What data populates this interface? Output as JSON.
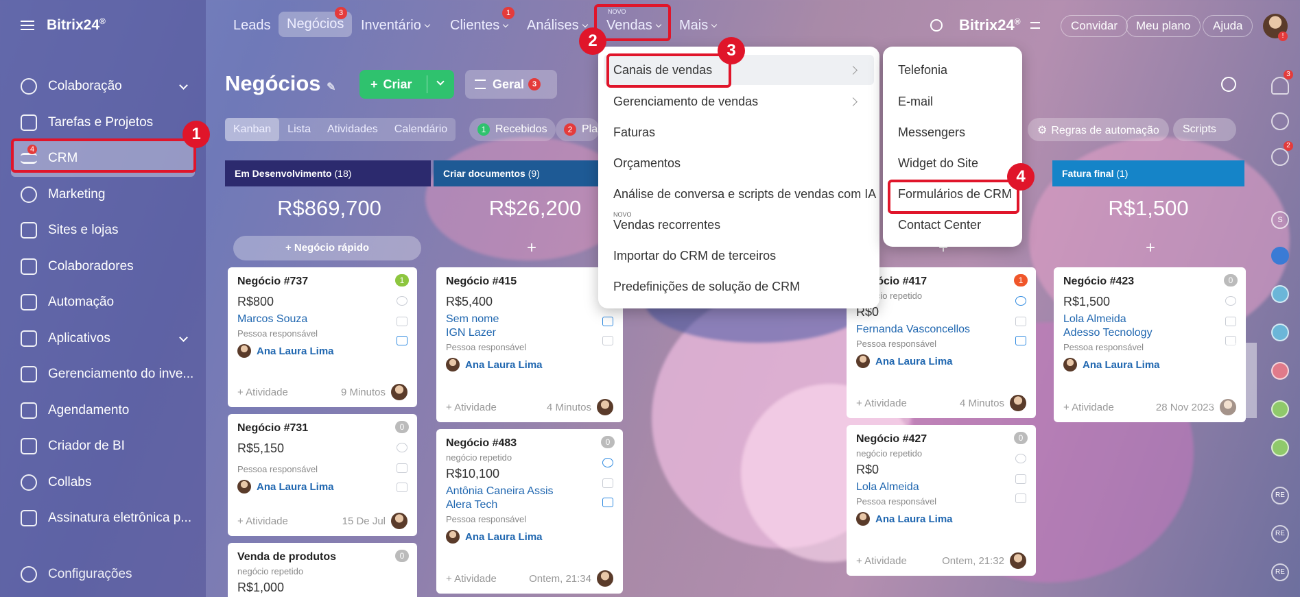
{
  "app": {
    "logo": "Bitrix24",
    "logo_mark": "®"
  },
  "sidebar": {
    "items": [
      {
        "label": "Colaboração",
        "chevron": true
      },
      {
        "label": "Tarefas e Projetos"
      },
      {
        "label": "CRM",
        "badge": "4"
      },
      {
        "label": "Marketing"
      },
      {
        "label": "Sites e lojas"
      },
      {
        "label": "Colaboradores"
      },
      {
        "label": "Automação"
      },
      {
        "label": "Aplicativos",
        "chevron": true
      },
      {
        "label": "Gerenciamento do inve..."
      },
      {
        "label": "Agendamento"
      },
      {
        "label": "Criador de BI"
      },
      {
        "label": "Collabs"
      },
      {
        "label": "Assinatura eletrônica p..."
      }
    ],
    "settings": "Configurações"
  },
  "topnav": {
    "leads": "Leads",
    "negocios": "Negócios",
    "negocios_badge": "3",
    "inventario": "Inventário",
    "clientes": "Clientes",
    "clientes_badge": "1",
    "analises": "Análises",
    "vendas_new": "NOVO",
    "vendas": "Vendas",
    "mais": "Mais",
    "brand": "Bitrix24",
    "invite": "Convidar",
    "plan": "Meu plano",
    "help": "Ajuda"
  },
  "page": {
    "title": "Negócios",
    "create": "Criar",
    "filter": "Geral",
    "filter_badge": "3",
    "views": [
      "Kanban",
      "Lista",
      "Atividades",
      "Calendário"
    ],
    "received_count": "1",
    "received": "Recebidos",
    "planned_count": "2",
    "planned": "Pla",
    "automation": "Regras de automação",
    "scripts": "Scripts"
  },
  "columns": [
    {
      "name": "Em Desenvolvimento",
      "count": "(18)",
      "sum": "R$869,700",
      "quick": "Negócio rápido",
      "color": "#2c2a6e"
    },
    {
      "name": "Criar documentos",
      "count": "(9)",
      "sum": "R$26,200",
      "color": "#1e5a95"
    },
    {
      "name": "Fatura final",
      "count": "(1)",
      "sum": "R$1,500",
      "color": "#1584c8"
    }
  ],
  "cards": {
    "c737": {
      "name": "Negócio #737",
      "amount": "R$800",
      "client": "Marcos Souza",
      "resp": "Pessoa responsável",
      "user": "Ana Laura Lima",
      "act": "+ Atividade",
      "time": "9 Minutos",
      "badge": "1"
    },
    "c731": {
      "name": "Negócio #731",
      "amount": "R$5,150",
      "resp": "Pessoa responsável",
      "user": "Ana Laura Lima",
      "act": "+ Atividade",
      "time": "15 De Jul",
      "badge": "0"
    },
    "cvp": {
      "name": "Venda de produtos",
      "sub": "negócio repetido",
      "amount": "R$1,000",
      "badge": "0"
    },
    "c415": {
      "name": "Negócio #415",
      "amount": "R$5,400",
      "client": "Sem nome",
      "company": "IGN Lazer",
      "resp": "Pessoa responsável",
      "user": "Ana Laura Lima",
      "act": "+ Atividade",
      "time": "4 Minutos"
    },
    "c483": {
      "name": "Negócio #483",
      "sub": "negócio repetido",
      "amount": "R$10,100",
      "client": "Antônia Caneira Assis",
      "company": "Alera Tech",
      "resp": "Pessoa responsável",
      "user": "Ana Laura Lima",
      "act": "+ Atividade",
      "time": "Ontem, 21:34",
      "badge": "0"
    },
    "c417": {
      "name": "Negócio #417",
      "sub": "negócio repetido",
      "amount": "R$0",
      "client": "Fernanda Vasconcellos",
      "resp": "Pessoa responsável",
      "user": "Ana Laura Lima",
      "act": "+ Atividade",
      "time": "4 Minutos",
      "badge": "1"
    },
    "c427": {
      "name": "Negócio #427",
      "sub": "negócio repetido",
      "amount": "R$0",
      "client": "Lola Almeida",
      "resp": "Pessoa responsável",
      "user": "Ana Laura Lima",
      "act": "+ Atividade",
      "time": "Ontem, 21:32",
      "badge": "0"
    },
    "c423": {
      "name": "Negócio #423",
      "amount": "R$1,500",
      "client": "Lola Almeida",
      "company": "Adesso Tecnology",
      "resp": "Pessoa responsável",
      "user": "Ana Laura Lima",
      "act": "+ Atividade",
      "time": "28 Nov 2023",
      "badge": "0"
    }
  },
  "vendas_menu": [
    {
      "label": "Canais de vendas",
      "arrow": true
    },
    {
      "label": "Gerenciamento de vendas",
      "arrow": true
    },
    {
      "label": "Faturas"
    },
    {
      "label": "Orçamentos"
    },
    {
      "label": "Análise de conversa e scripts de vendas com IA"
    },
    {
      "label": "Vendas recorrentes",
      "tag": "NOVO"
    },
    {
      "label": "Importar do CRM de terceiros"
    },
    {
      "label": "Predefinições de solução de CRM"
    }
  ],
  "canais_menu": [
    "Telefonia",
    "E-mail",
    "Messengers",
    "Widget do Site",
    "Formulários de CRM",
    "Contact Center"
  ],
  "steps": [
    "1",
    "2",
    "3",
    "4"
  ],
  "rail": {
    "notif_badge": "3",
    "chat_badge": "2",
    "avatar_s": "S",
    "re1": "RE",
    "re2": "RE",
    "re3": "RE"
  }
}
